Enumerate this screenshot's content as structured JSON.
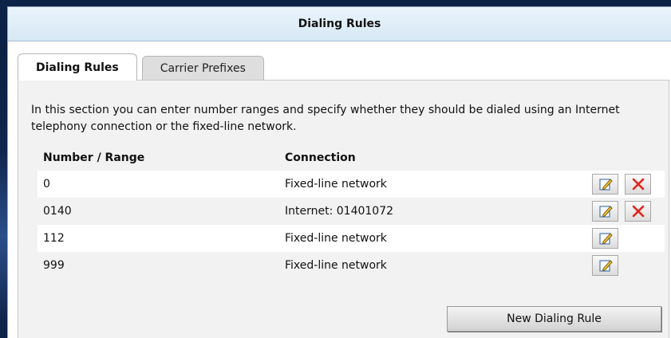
{
  "panel": {
    "title": "Dialing Rules"
  },
  "tabs": [
    {
      "label": "Dialing Rules",
      "active": true
    },
    {
      "label": "Carrier Prefixes",
      "active": false
    }
  ],
  "intro_text": "In this section you can enter number ranges and specify whether they should be dialed using an Internet telephony connection or the fixed-line network.",
  "table": {
    "headers": [
      "Number / Range",
      "Connection"
    ],
    "rows": [
      {
        "number": "0",
        "connection": "Fixed-line network",
        "edit_icon": "edit-icon",
        "delete_icon": "delete-icon"
      },
      {
        "number": "0140",
        "connection": "Internet: 01401072",
        "edit_icon": "edit-icon",
        "delete_icon": "delete-icon"
      },
      {
        "number": "112",
        "connection": "Fixed-line network",
        "edit_icon": "edit-icon"
      },
      {
        "number": "999",
        "connection": "Fixed-line network",
        "edit_icon": "edit-icon"
      }
    ]
  },
  "new_rule_button": "New Dialing Rule",
  "colors": {
    "header_bg": "#d6e8f5",
    "delete_red": "#e2231a",
    "tab_inactive": "#dedede"
  }
}
